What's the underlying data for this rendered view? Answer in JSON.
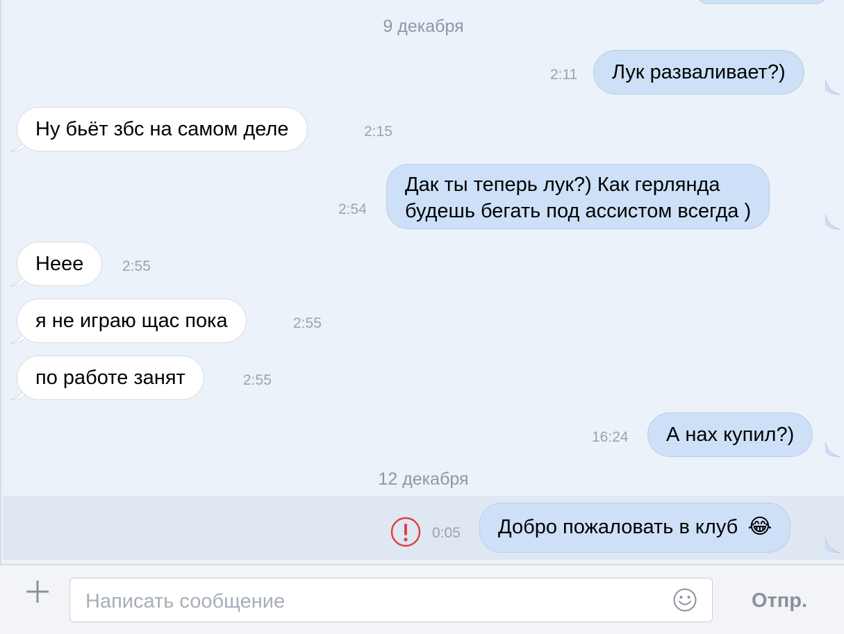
{
  "chat": {
    "date_separators": [
      "9 декабря",
      "12 декабря"
    ],
    "messages": [
      {
        "direction": "out",
        "text": "Лук разваливает?)",
        "time": "2:11"
      },
      {
        "direction": "in",
        "text": "Ну бьёт збс на самом деле",
        "time": "2:15"
      },
      {
        "direction": "out",
        "lines": [
          "Дак ты теперь лук?) Как герлянда",
          "будешь бегать под ассистом всегда )"
        ],
        "time": "2:54"
      },
      {
        "direction": "in",
        "text": "Неее",
        "time": "2:55"
      },
      {
        "direction": "in",
        "text": "я не играю щас пока",
        "time": "2:55"
      },
      {
        "direction": "in",
        "text": "по работе занят",
        "time": "2:55"
      },
      {
        "direction": "out",
        "text": "А нах купил?)",
        "time": "16:24"
      },
      {
        "direction": "out",
        "text": "Добро пожаловать в клуб",
        "emoji": "😂",
        "time": "0:05",
        "status": "error"
      }
    ]
  },
  "composer": {
    "placeholder": "Написать сообщение",
    "value": "",
    "send_label": "Отпр.",
    "attach_icon": "plus-icon",
    "emoji_icon": "smiley-icon"
  },
  "colors": {
    "background": "#ecf2fa",
    "incoming_bubble": "#ffffff",
    "outgoing_bubble": "#cde0f8",
    "error": "#e0413d"
  }
}
